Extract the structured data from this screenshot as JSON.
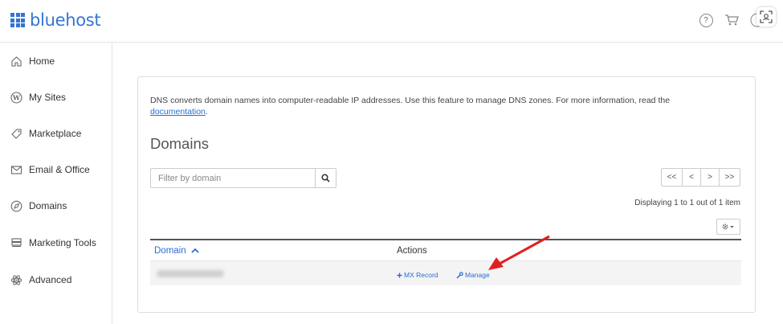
{
  "header": {
    "logo_text": "bluehost",
    "help_badge": "?",
    "brand_color": "#3575d3",
    "icons": [
      "help-icon",
      "cart-icon",
      "account-icon",
      "scan-icon"
    ]
  },
  "sidebar": {
    "items": [
      {
        "label": "Home",
        "icon": "home-icon"
      },
      {
        "label": "My Sites",
        "icon": "wordpress-icon"
      },
      {
        "label": "Marketplace",
        "icon": "tag-icon"
      },
      {
        "label": "Email & Office",
        "icon": "envelope-icon"
      },
      {
        "label": "Domains",
        "icon": "compass-icon"
      },
      {
        "label": "Marketing Tools",
        "icon": "stack-icon"
      },
      {
        "label": "Advanced",
        "icon": "atom-icon"
      }
    ]
  },
  "panel": {
    "intro_text": "DNS converts domain names into computer-readable IP addresses. Use this feature to manage DNS zones. For more information, read the",
    "intro_link": "documentation",
    "intro_end": ".",
    "title": "Domains",
    "filter_placeholder": "Filter by domain",
    "pager": {
      "first": "<<",
      "prev": "<",
      "next": ">",
      "last": ">>"
    },
    "display_text": "Displaying 1 to 1 out of 1 item",
    "table": {
      "headers": {
        "domain": "Domain",
        "actions": "Actions"
      },
      "rows": [
        {
          "domain": "",
          "actions": {
            "mx": "MX Record",
            "manage": "Manage"
          }
        }
      ]
    },
    "link_color": "#2a6ed4",
    "annotation_arrow_color": "#e02020"
  }
}
